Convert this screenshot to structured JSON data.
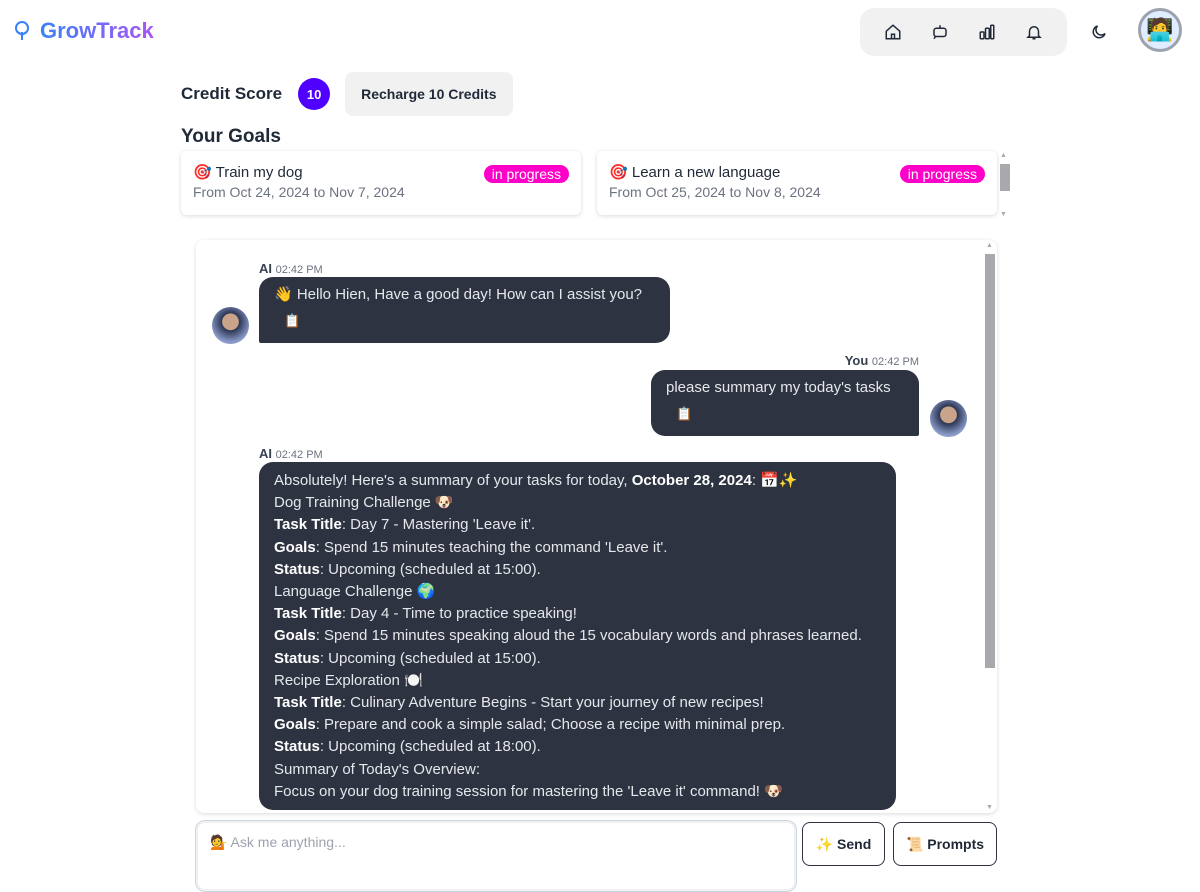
{
  "app": {
    "name": "GrowTrack"
  },
  "nav": {
    "icons": [
      "home-icon",
      "chatbot-icon",
      "chart-icon",
      "bell-icon"
    ],
    "theme_icon": "moon-icon"
  },
  "credit": {
    "label": "Credit Score",
    "value": "10",
    "recharge_label": "Recharge 10 Credits",
    "badge_color": "#4f00ff"
  },
  "goals": {
    "title": "Your Goals",
    "items": [
      {
        "icon": "🎯",
        "title": "Train my dog",
        "dates": "From Oct 24, 2024 to Nov 7, 2024",
        "status": "in progress"
      },
      {
        "icon": "🎯",
        "title": "Learn a new language",
        "dates": "From Oct 25, 2024 to Nov 8, 2024",
        "status": "in progress"
      }
    ]
  },
  "messages": [
    {
      "sender": "AI",
      "time": "02:42 PM",
      "text": "👋 Hello Hien, Have a good day! How can I assist you?"
    },
    {
      "sender": "You",
      "time": "02:42 PM",
      "text": "please summary my today's tasks"
    },
    {
      "sender": "AI",
      "time": "02:42 PM",
      "lines": [
        {
          "pre": "Absolutely! Here's a summary of your tasks for today, ",
          "bold": "October 28, 2024",
          "post": ": 📅✨"
        },
        {
          "pre": "Dog Training Challenge 🐶"
        },
        {
          "bold": "Task Title",
          "post": ": Day 7 - Mastering 'Leave it'."
        },
        {
          "bold": "Goals",
          "post": ": Spend 15 minutes teaching the command 'Leave it'."
        },
        {
          "bold": "Status",
          "post": ": Upcoming (scheduled at 15:00)."
        },
        {
          "pre": "Language Challenge 🌍"
        },
        {
          "bold": "Task Title",
          "post": ": Day 4 - Time to practice speaking!"
        },
        {
          "bold": "Goals",
          "post": ": Spend 15 minutes speaking aloud the 15 vocabulary words and phrases learned."
        },
        {
          "bold": "Status",
          "post": ": Upcoming (scheduled at 15:00)."
        },
        {
          "pre": "Recipe Exploration 🍽️"
        },
        {
          "bold": "Task Title",
          "post": ": Culinary Adventure Begins - Start your journey of new recipes!"
        },
        {
          "bold": "Goals",
          "post": ": Prepare and cook a simple salad; Choose a recipe with minimal prep."
        },
        {
          "bold": "Status",
          "post": ": Upcoming (scheduled at 18:00)."
        },
        {
          "pre": "Summary of Today's Overview:"
        },
        {
          "pre": "Focus on your dog training session for mastering the 'Leave it' command! 🐶"
        }
      ]
    }
  ],
  "composer": {
    "placeholder": "💁 Ask me anything...",
    "send_label": "✨ Send",
    "prompts_label": "📜 Prompts"
  }
}
